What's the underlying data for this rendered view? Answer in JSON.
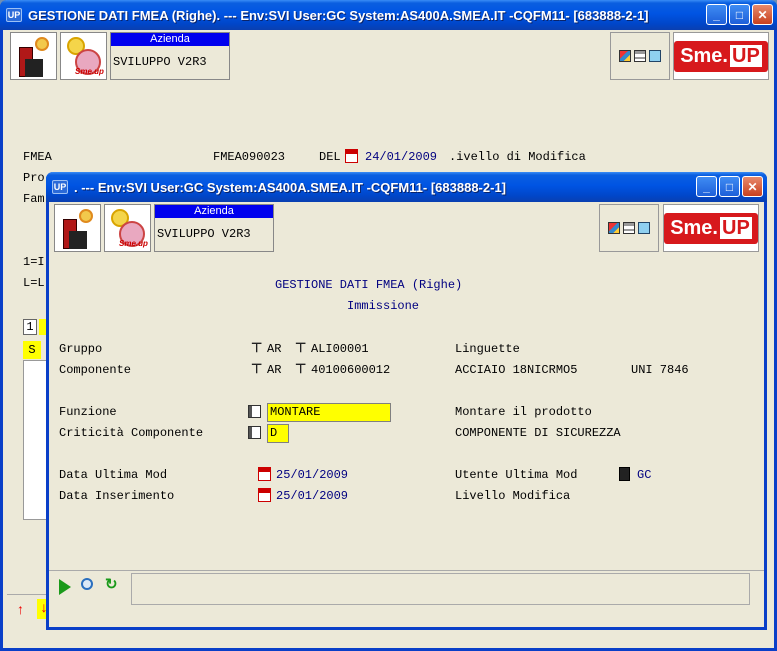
{
  "back_window": {
    "title": "GESTIONE DATI FMEA (Righe). --- Env:SVI User:GC System:AS400A.SMEA.IT -CQFM11- [683888-2-1]",
    "azienda_label": "Azienda",
    "azienda_value": "SVILUPPO V2R3",
    "smeup_text": "Sme.",
    "smeup_up": "UP",
    "fmea_label": "FMEA",
    "fmea_code": "FMEA090023",
    "del_label": "DEL",
    "fmea_date": "24/01/2009",
    "livello_text": ".ivello di Modifica",
    "row_pro": "Pro",
    "row_fam": "Fam",
    "row_1": "1=I",
    "row_l": "L=L",
    "tab_1": "1",
    "col_s": "S"
  },
  "front_window": {
    "title": ". --- Env:SVI User:GC System:AS400A.SMEA.IT -CQFM11- [683888-2-1]",
    "azienda_label": "Azienda",
    "azienda_value": "SVILUPPO V2R3",
    "smeup_text": "Sme.",
    "smeup_up": "UP",
    "heading": "GESTIONE DATI FMEA (Righe)",
    "subheading": "Immissione",
    "fields": {
      "gruppo_label": "Gruppo",
      "gruppo_type": "AR",
      "gruppo_code": "ALI00001",
      "gruppo_desc": "Linguette",
      "componente_label": "Componente",
      "componente_type": "AR",
      "componente_code": "40100600012",
      "componente_desc1": "ACCIAIO 18NICRMO5",
      "componente_desc2": "UNI 7846",
      "funzione_label": "Funzione",
      "funzione_value": "MONTARE",
      "funzione_desc": "Montare il prodotto",
      "criticita_label": "Criticità Componente",
      "criticita_value": "D",
      "criticita_desc": "COMPONENTE DI SICUREZZA",
      "data_ultima_label": "Data Ultima Mod",
      "data_ultima_value": "25/01/2009",
      "utente_label": "Utente Ultima Mod",
      "utente_value": "GC",
      "data_ins_label": "Data Inserimento",
      "data_ins_value": "25/01/2009",
      "livello_label": "Livello Modifica"
    }
  }
}
